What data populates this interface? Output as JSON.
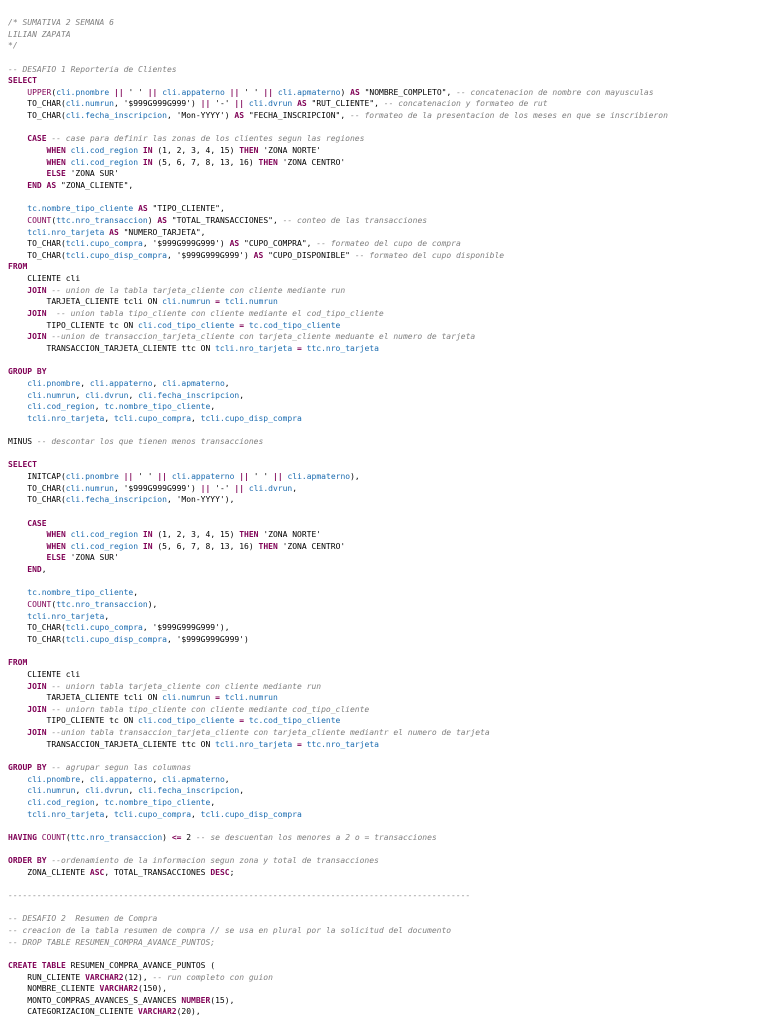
{
  "colors": {
    "background": "#ffffff",
    "comment": "#808080",
    "keyword": "#7f0055",
    "identifier": "#1c6cb0",
    "text": "#000000"
  },
  "code_lines": [
    [
      [
        "c",
        "/* SUMATIVA 2 SEMANA 6"
      ]
    ],
    [
      [
        "c",
        "LILIAN ZAPATA"
      ]
    ],
    [
      [
        "c",
        "*/"
      ]
    ],
    [],
    [
      [
        "c",
        "-- DESAFIO 1 Reporteria de Clientes"
      ]
    ],
    [
      [
        "k",
        "SELECT"
      ]
    ],
    [
      [
        "p",
        "    "
      ],
      [
        "f",
        "UPPER"
      ],
      [
        "p",
        "("
      ],
      [
        "i",
        "cli.pnombre"
      ],
      [
        "p",
        " "
      ],
      [
        "k",
        "||"
      ],
      [
        "p",
        " ' ' "
      ],
      [
        "k",
        "||"
      ],
      [
        "p",
        " "
      ],
      [
        "i",
        "cli.appaterno"
      ],
      [
        "p",
        " "
      ],
      [
        "k",
        "||"
      ],
      [
        "p",
        " ' ' "
      ],
      [
        "k",
        "||"
      ],
      [
        "p",
        " "
      ],
      [
        "i",
        "cli.apmaterno"
      ],
      [
        "p",
        ") "
      ],
      [
        "k",
        "AS"
      ],
      [
        "p",
        " \"NOMBRE_COMPLETO\", "
      ],
      [
        "c",
        "-- concatenacion de nombre con mayusculas"
      ]
    ],
    [
      [
        "p",
        "    TO_CHAR("
      ],
      [
        "i",
        "cli.numrun"
      ],
      [
        "p",
        ", '$999G999G999') "
      ],
      [
        "k",
        "||"
      ],
      [
        "p",
        " '-' "
      ],
      [
        "k",
        "||"
      ],
      [
        "p",
        " "
      ],
      [
        "i",
        "cli.dvrun"
      ],
      [
        "p",
        " "
      ],
      [
        "k",
        "AS"
      ],
      [
        "p",
        " \"RUT_CLIENTE\", "
      ],
      [
        "c",
        "-- concatenacion y formateo de rut"
      ]
    ],
    [
      [
        "p",
        "    TO_CHAR("
      ],
      [
        "i",
        "cli.fecha_inscripcion"
      ],
      [
        "p",
        ", 'Mon-YYYY') "
      ],
      [
        "k",
        "AS"
      ],
      [
        "p",
        " \"FECHA_INSCRIPCION\", "
      ],
      [
        "c",
        "-- formateo de la presentacion de los meses en que se inscribieron"
      ]
    ],
    [],
    [
      [
        "p",
        "    "
      ],
      [
        "k",
        "CASE"
      ],
      [
        "p",
        " "
      ],
      [
        "c",
        "-- case para definir las zonas de los clientes segun las regiones"
      ]
    ],
    [
      [
        "p",
        "        "
      ],
      [
        "k",
        "WHEN"
      ],
      [
        "p",
        " "
      ],
      [
        "i",
        "cli.cod_region"
      ],
      [
        "p",
        " "
      ],
      [
        "k",
        "IN"
      ],
      [
        "p",
        " (1, 2, 3, 4, 15) "
      ],
      [
        "k",
        "THEN"
      ],
      [
        "p",
        " 'ZONA NORTE'"
      ]
    ],
    [
      [
        "p",
        "        "
      ],
      [
        "k",
        "WHEN"
      ],
      [
        "p",
        " "
      ],
      [
        "i",
        "cli.cod_region"
      ],
      [
        "p",
        " "
      ],
      [
        "k",
        "IN"
      ],
      [
        "p",
        " (5, 6, 7, 8, 13, 16) "
      ],
      [
        "k",
        "THEN"
      ],
      [
        "p",
        " 'ZONA CENTRO'"
      ]
    ],
    [
      [
        "p",
        "        "
      ],
      [
        "k",
        "ELSE"
      ],
      [
        "p",
        " 'ZONA SUR'"
      ]
    ],
    [
      [
        "p",
        "    "
      ],
      [
        "k",
        "END"
      ],
      [
        "p",
        " "
      ],
      [
        "k",
        "AS"
      ],
      [
        "p",
        " \"ZONA_CLIENTE\","
      ]
    ],
    [],
    [
      [
        "p",
        "    "
      ],
      [
        "i",
        "tc.nombre_tipo_cliente"
      ],
      [
        "p",
        " "
      ],
      [
        "k",
        "AS"
      ],
      [
        "p",
        " \"TIPO_CLIENTE\","
      ]
    ],
    [
      [
        "p",
        "    "
      ],
      [
        "f",
        "COUNT"
      ],
      [
        "p",
        "("
      ],
      [
        "i",
        "ttc.nro_transaccion"
      ],
      [
        "p",
        ") "
      ],
      [
        "k",
        "AS"
      ],
      [
        "p",
        " \"TOTAL_TRANSACCIONES\", "
      ],
      [
        "c",
        "-- conteo de las transacciones"
      ]
    ],
    [
      [
        "p",
        "    "
      ],
      [
        "i",
        "tcli.nro_tarjeta"
      ],
      [
        "p",
        " "
      ],
      [
        "k",
        "AS"
      ],
      [
        "p",
        " \"NUMERO_TARJETA\","
      ]
    ],
    [
      [
        "p",
        "    TO_CHAR("
      ],
      [
        "i",
        "tcli.cupo_compra"
      ],
      [
        "p",
        ", '$999G999G999') "
      ],
      [
        "k",
        "AS"
      ],
      [
        "p",
        " \"CUPO_COMPRA\", "
      ],
      [
        "c",
        "-- formateo del cupo de compra"
      ]
    ],
    [
      [
        "p",
        "    TO_CHAR("
      ],
      [
        "i",
        "tcli.cupo_disp_compra"
      ],
      [
        "p",
        ", '$999G999G999') "
      ],
      [
        "k",
        "AS"
      ],
      [
        "p",
        " \"CUPO_DISPONIBLE\" "
      ],
      [
        "c",
        "-- formateo del cupo disponible"
      ]
    ],
    [
      [
        "k",
        "FROM"
      ]
    ],
    [
      [
        "p",
        "    CLIENTE cli"
      ]
    ],
    [
      [
        "p",
        "    "
      ],
      [
        "k",
        "JOIN"
      ],
      [
        "p",
        " "
      ],
      [
        "c",
        "-- union de la tabla tarjeta_cliente con cliente mediante run"
      ]
    ],
    [
      [
        "p",
        "        TARJETA_CLIENTE tcli ON "
      ],
      [
        "i",
        "cli.numrun"
      ],
      [
        "p",
        " "
      ],
      [
        "k",
        "="
      ],
      [
        "p",
        " "
      ],
      [
        "i",
        "tcli.numrun"
      ]
    ],
    [
      [
        "p",
        "    "
      ],
      [
        "k",
        "JOIN"
      ],
      [
        "p",
        "  "
      ],
      [
        "c",
        "-- union tabla tipo_cliente con cliente mediante el cod_tipo_cliente"
      ]
    ],
    [
      [
        "p",
        "        TIPO_CLIENTE tc ON "
      ],
      [
        "i",
        "cli.cod_tipo_cliente"
      ],
      [
        "p",
        " "
      ],
      [
        "k",
        "="
      ],
      [
        "p",
        " "
      ],
      [
        "i",
        "tc.cod_tipo_cliente"
      ]
    ],
    [
      [
        "p",
        "    "
      ],
      [
        "k",
        "JOIN"
      ],
      [
        "p",
        " "
      ],
      [
        "c",
        "--union de transaccion_tarjeta_cliente con tarjeta_cliente meduante el numero de tarjeta"
      ]
    ],
    [
      [
        "p",
        "        TRANSACCION_TARJETA_CLIENTE ttc ON "
      ],
      [
        "i",
        "tcli.nro_tarjeta"
      ],
      [
        "p",
        " "
      ],
      [
        "k",
        "="
      ],
      [
        "p",
        " "
      ],
      [
        "i",
        "ttc.nro_tarjeta"
      ]
    ],
    [],
    [
      [
        "k",
        "GROUP BY"
      ]
    ],
    [
      [
        "p",
        "    "
      ],
      [
        "i",
        "cli.pnombre"
      ],
      [
        "p",
        ", "
      ],
      [
        "i",
        "cli.appaterno"
      ],
      [
        "p",
        ", "
      ],
      [
        "i",
        "cli.apmaterno"
      ],
      [
        "p",
        ","
      ]
    ],
    [
      [
        "p",
        "    "
      ],
      [
        "i",
        "cli.numrun"
      ],
      [
        "p",
        ", "
      ],
      [
        "i",
        "cli.dvrun"
      ],
      [
        "p",
        ", "
      ],
      [
        "i",
        "cli.fecha_inscripcion"
      ],
      [
        "p",
        ","
      ]
    ],
    [
      [
        "p",
        "    "
      ],
      [
        "i",
        "cli.cod_region"
      ],
      [
        "p",
        ", "
      ],
      [
        "i",
        "tc.nombre_tipo_cliente"
      ],
      [
        "p",
        ","
      ]
    ],
    [
      [
        "p",
        "    "
      ],
      [
        "i",
        "tcli.nro_tarjeta"
      ],
      [
        "p",
        ", "
      ],
      [
        "i",
        "tcli.cupo_compra"
      ],
      [
        "p",
        ", "
      ],
      [
        "i",
        "tcli.cupo_disp_compra"
      ]
    ],
    [],
    [
      [
        "p",
        "MINUS "
      ],
      [
        "c",
        "-- descontar los que tienen menos transacciones"
      ]
    ],
    [],
    [
      [
        "k",
        "SELECT"
      ]
    ],
    [
      [
        "p",
        "    INITCAP("
      ],
      [
        "i",
        "cli.pnombre"
      ],
      [
        "p",
        " "
      ],
      [
        "k",
        "||"
      ],
      [
        "p",
        " ' ' "
      ],
      [
        "k",
        "||"
      ],
      [
        "p",
        " "
      ],
      [
        "i",
        "cli.appaterno"
      ],
      [
        "p",
        " "
      ],
      [
        "k",
        "||"
      ],
      [
        "p",
        " ' ' "
      ],
      [
        "k",
        "||"
      ],
      [
        "p",
        " "
      ],
      [
        "i",
        "cli.apmaterno"
      ],
      [
        "p",
        "),"
      ]
    ],
    [
      [
        "p",
        "    TO_CHAR("
      ],
      [
        "i",
        "cli.numrun"
      ],
      [
        "p",
        ", '$999G999G999') "
      ],
      [
        "k",
        "||"
      ],
      [
        "p",
        " '-' "
      ],
      [
        "k",
        "||"
      ],
      [
        "p",
        " "
      ],
      [
        "i",
        "cli.dvrun"
      ],
      [
        "p",
        ","
      ]
    ],
    [
      [
        "p",
        "    TO_CHAR("
      ],
      [
        "i",
        "cli.fecha_inscripcion"
      ],
      [
        "p",
        ", 'Mon-YYYY'),"
      ]
    ],
    [],
    [
      [
        "p",
        "    "
      ],
      [
        "k",
        "CASE"
      ]
    ],
    [
      [
        "p",
        "        "
      ],
      [
        "k",
        "WHEN"
      ],
      [
        "p",
        " "
      ],
      [
        "i",
        "cli.cod_region"
      ],
      [
        "p",
        " "
      ],
      [
        "k",
        "IN"
      ],
      [
        "p",
        " (1, 2, 3, 4, 15) "
      ],
      [
        "k",
        "THEN"
      ],
      [
        "p",
        " 'ZONA NORTE'"
      ]
    ],
    [
      [
        "p",
        "        "
      ],
      [
        "k",
        "WHEN"
      ],
      [
        "p",
        " "
      ],
      [
        "i",
        "cli.cod_region"
      ],
      [
        "p",
        " "
      ],
      [
        "k",
        "IN"
      ],
      [
        "p",
        " (5, 6, 7, 8, 13, 16) "
      ],
      [
        "k",
        "THEN"
      ],
      [
        "p",
        " 'ZONA CENTRO'"
      ]
    ],
    [
      [
        "p",
        "        "
      ],
      [
        "k",
        "ELSE"
      ],
      [
        "p",
        " 'ZONA SUR'"
      ]
    ],
    [
      [
        "p",
        "    "
      ],
      [
        "k",
        "END"
      ],
      [
        "p",
        ","
      ]
    ],
    [],
    [
      [
        "p",
        "    "
      ],
      [
        "i",
        "tc.nombre_tipo_cliente"
      ],
      [
        "p",
        ","
      ]
    ],
    [
      [
        "p",
        "    "
      ],
      [
        "f",
        "COUNT"
      ],
      [
        "p",
        "("
      ],
      [
        "i",
        "ttc.nro_transaccion"
      ],
      [
        "p",
        "),"
      ]
    ],
    [
      [
        "p",
        "    "
      ],
      [
        "i",
        "tcli.nro_tarjeta"
      ],
      [
        "p",
        ","
      ]
    ],
    [
      [
        "p",
        "    TO_CHAR("
      ],
      [
        "i",
        "tcli.cupo_compra"
      ],
      [
        "p",
        ", '$999G999G999'),"
      ]
    ],
    [
      [
        "p",
        "    TO_CHAR("
      ],
      [
        "i",
        "tcli.cupo_disp_compra"
      ],
      [
        "p",
        ", '$999G999G999')"
      ]
    ],
    [],
    [
      [
        "k",
        "FROM"
      ]
    ],
    [
      [
        "p",
        "    CLIENTE cli"
      ]
    ],
    [
      [
        "p",
        "    "
      ],
      [
        "k",
        "JOIN"
      ],
      [
        "p",
        " "
      ],
      [
        "c",
        "-- uniorn tabla tarjeta_cliente con cliente mediante run"
      ]
    ],
    [
      [
        "p",
        "        TARJETA_CLIENTE tcli ON "
      ],
      [
        "i",
        "cli.numrun"
      ],
      [
        "p",
        " "
      ],
      [
        "k",
        "="
      ],
      [
        "p",
        " "
      ],
      [
        "i",
        "tcli.numrun"
      ]
    ],
    [
      [
        "p",
        "    "
      ],
      [
        "k",
        "JOIN"
      ],
      [
        "p",
        " "
      ],
      [
        "c",
        "-- uniorn tabla tipo_cliente con cliente mediante cod_tipo_cliente"
      ]
    ],
    [
      [
        "p",
        "        TIPO_CLIENTE tc ON "
      ],
      [
        "i",
        "cli.cod_tipo_cliente"
      ],
      [
        "p",
        " "
      ],
      [
        "k",
        "="
      ],
      [
        "p",
        " "
      ],
      [
        "i",
        "tc.cod_tipo_cliente"
      ]
    ],
    [
      [
        "p",
        "    "
      ],
      [
        "k",
        "JOIN"
      ],
      [
        "p",
        " "
      ],
      [
        "c",
        "--union tabla transaccion_tarjeta_cliente con tarjeta_cliente mediantr el numero de tarjeta"
      ]
    ],
    [
      [
        "p",
        "        TRANSACCION_TARJETA_CLIENTE ttc ON "
      ],
      [
        "i",
        "tcli.nro_tarjeta"
      ],
      [
        "p",
        " "
      ],
      [
        "k",
        "="
      ],
      [
        "p",
        " "
      ],
      [
        "i",
        "ttc.nro_tarjeta"
      ]
    ],
    [],
    [
      [
        "k",
        "GROUP BY"
      ],
      [
        "p",
        " "
      ],
      [
        "c",
        "-- agrupar segun las columnas"
      ]
    ],
    [
      [
        "p",
        "    "
      ],
      [
        "i",
        "cli.pnombre"
      ],
      [
        "p",
        ", "
      ],
      [
        "i",
        "cli.appaterno"
      ],
      [
        "p",
        ", "
      ],
      [
        "i",
        "cli.apmaterno"
      ],
      [
        "p",
        ","
      ]
    ],
    [
      [
        "p",
        "    "
      ],
      [
        "i",
        "cli.numrun"
      ],
      [
        "p",
        ", "
      ],
      [
        "i",
        "cli.dvrun"
      ],
      [
        "p",
        ", "
      ],
      [
        "i",
        "cli.fecha_inscripcion"
      ],
      [
        "p",
        ","
      ]
    ],
    [
      [
        "p",
        "    "
      ],
      [
        "i",
        "cli.cod_region"
      ],
      [
        "p",
        ", "
      ],
      [
        "i",
        "tc.nombre_tipo_cliente"
      ],
      [
        "p",
        ","
      ]
    ],
    [
      [
        "p",
        "    "
      ],
      [
        "i",
        "tcli.nro_tarjeta"
      ],
      [
        "p",
        ", "
      ],
      [
        "i",
        "tcli.cupo_compra"
      ],
      [
        "p",
        ", "
      ],
      [
        "i",
        "tcli.cupo_disp_compra"
      ]
    ],
    [],
    [
      [
        "k",
        "HAVING"
      ],
      [
        "p",
        " "
      ],
      [
        "f",
        "COUNT"
      ],
      [
        "p",
        "("
      ],
      [
        "i",
        "ttc.nro_transaccion"
      ],
      [
        "p",
        ") "
      ],
      [
        "k",
        "<="
      ],
      [
        "p",
        " 2 "
      ],
      [
        "c",
        "-- se descuentan los menores a 2 o = transacciones"
      ]
    ],
    [],
    [
      [
        "k",
        "ORDER BY"
      ],
      [
        "p",
        " "
      ],
      [
        "c",
        "--ordenamiento de la informacion segun zona y total de transacciones"
      ]
    ],
    [
      [
        "p",
        "    ZONA_CLIENTE "
      ],
      [
        "k",
        "ASC"
      ],
      [
        "p",
        ", TOTAL_TRANSACCIONES "
      ],
      [
        "k",
        "DESC"
      ],
      [
        "p",
        ";"
      ]
    ],
    [],
    [
      [
        "c",
        "------------------------------------------------------------------------------------------------"
      ]
    ],
    [],
    [
      [
        "c",
        "-- DESAFIO 2  Resumen de Compra"
      ]
    ],
    [
      [
        "c",
        "-- creacion de la tabla resumen de compra // se usa en plural por la solicitud del documento"
      ]
    ],
    [
      [
        "c",
        "-- DROP TABLE RESUMEN_COMPRA_AVANCE_PUNTOS;"
      ]
    ],
    [],
    [
      [
        "k",
        "CREATE TABLE"
      ],
      [
        "p",
        " RESUMEN_COMPRA_AVANCE_PUNTOS ("
      ]
    ],
    [
      [
        "p",
        "    RUN_CLIENTE "
      ],
      [
        "k",
        "VARCHAR2"
      ],
      [
        "p",
        "(12), "
      ],
      [
        "c",
        "-- run completo con guion"
      ]
    ],
    [
      [
        "p",
        "    NOMBRE_CLIENTE "
      ],
      [
        "k",
        "VARCHAR2"
      ],
      [
        "p",
        "(150),"
      ]
    ],
    [
      [
        "p",
        "    MONTO_COMPRAS_AVANCES_S_AVANCES "
      ],
      [
        "k",
        "NUMBER"
      ],
      [
        "p",
        "(15),"
      ]
    ],
    [
      [
        "p",
        "    CATEGORIZACION_CLIENTE "
      ],
      [
        "k",
        "VARCHAR2"
      ],
      [
        "p",
        "(20),"
      ]
    ]
  ]
}
